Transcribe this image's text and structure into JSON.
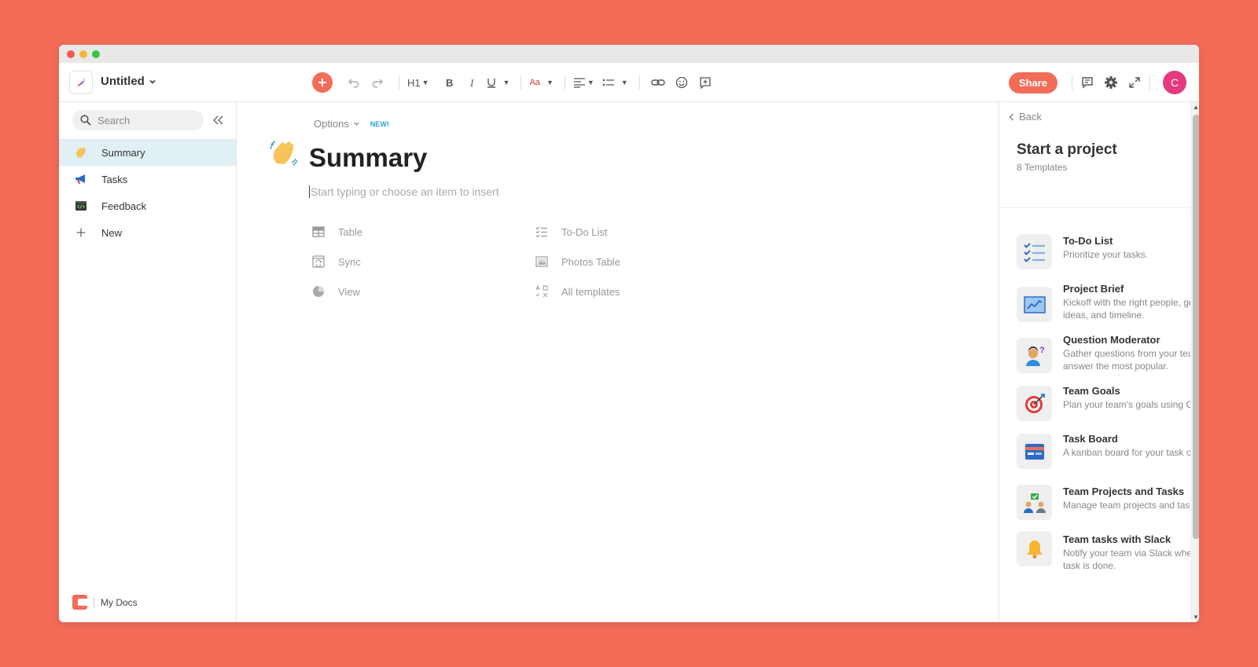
{
  "window": {
    "controls": [
      "close",
      "minimize",
      "maximize"
    ]
  },
  "header": {
    "doc_title": "Untitled",
    "heading_label": "H1",
    "text_color_label": "Aa",
    "share_label": "Share",
    "avatar_initial": "C"
  },
  "sidebar": {
    "search_placeholder": "Search",
    "items": [
      {
        "label": "Summary",
        "icon": "waving-hand-icon",
        "active": true
      },
      {
        "label": "Tasks",
        "icon": "megaphone-icon",
        "active": false
      },
      {
        "label": "Feedback",
        "icon": "code-window-icon",
        "active": false
      },
      {
        "label": "New",
        "icon": "plus-icon",
        "active": false
      }
    ],
    "footer_label": "My Docs"
  },
  "editor": {
    "options_label": "Options",
    "new_badge": "NEW!",
    "page_title": "Summary",
    "placeholder": "Start typing or choose an item to insert",
    "inserts": [
      {
        "label": "Table",
        "icon": "table-icon"
      },
      {
        "label": "To-Do List",
        "icon": "checklist-icon"
      },
      {
        "label": "Sync",
        "icon": "sync-icon"
      },
      {
        "label": "Photos Table",
        "icon": "photo-icon"
      },
      {
        "label": "View",
        "icon": "pie-icon"
      },
      {
        "label": "All templates",
        "icon": "templates-icon"
      }
    ]
  },
  "panel": {
    "back_label": "Back",
    "title": "Start a project",
    "subtitle": "8 Templates",
    "templates": [
      {
        "name": "To-Do List",
        "desc": "Prioritize your tasks."
      },
      {
        "name": "Project Brief",
        "desc": "Kickoff with the right people, goals, ideas, and timeline."
      },
      {
        "name": "Question Moderator",
        "desc": "Gather questions from your team and answer the most popular."
      },
      {
        "name": "Team Goals",
        "desc": "Plan your team's goals using OKRs."
      },
      {
        "name": "Task Board",
        "desc": "A kanban board for your task cards."
      },
      {
        "name": "Team Projects and Tasks",
        "desc": "Manage team projects and tasks."
      },
      {
        "name": "Team tasks with Slack",
        "desc": "Notify your team via Slack when a task is done."
      }
    ]
  },
  "colors": {
    "accent": "#F26C58",
    "background": "#F26C58",
    "active_nav": "#E1F0F4",
    "avatar": "#E6397F",
    "new_badge": "#2AA3C8"
  }
}
